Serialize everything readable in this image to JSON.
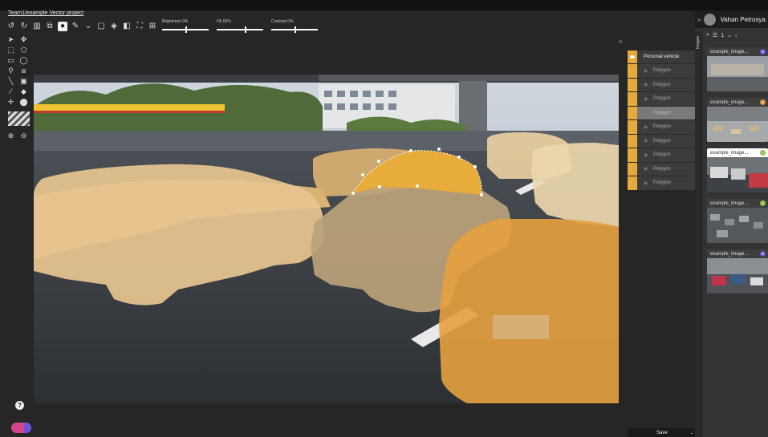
{
  "breadcrumb": {
    "team": "Team1",
    "separator": "/",
    "project": "example Vector project"
  },
  "toolbar": {
    "icons": [
      "undo-icon",
      "redo-icon",
      "trash-icon",
      "copy-icon",
      "eye-icon",
      "brush-icon",
      "chevron-down-icon",
      "comment-icon",
      "fill-icon",
      "fill-dark-icon",
      "fit-icon",
      "expand-icon"
    ],
    "sliders": [
      {
        "label": "Brightness 0%",
        "value": 0
      },
      {
        "label": "Fill 60%",
        "value": 60
      },
      {
        "label": "Contrast 0%",
        "value": 0
      }
    ]
  },
  "left_tools": {
    "rows": [
      [
        "cursor-icon",
        "crosshair-icon"
      ],
      [
        "polygon-select-icon",
        "polygon-icon"
      ],
      [
        "rectangle-icon",
        "ellipse-icon"
      ],
      [
        "template-icon",
        "cuboid-icon"
      ],
      [
        "line-icon",
        "comment-tool-icon"
      ],
      [
        "eyedropper-icon",
        "tag-icon"
      ],
      [
        "move-icon",
        "point-icon"
      ]
    ],
    "zoom": [
      "zoom-in-icon",
      "zoom-out-icon"
    ]
  },
  "colors": {
    "annotation": "#e6a93d",
    "selected_polygon": "#e7ac3a",
    "toggle_left": "#d6448e",
    "toggle_right": "#6b55d9"
  },
  "class_panel": {
    "class_name": "Personal vehicle",
    "items": [
      {
        "label": "Polygon",
        "selected": false
      },
      {
        "label": "Polygon",
        "selected": false
      },
      {
        "label": "Polygon",
        "selected": false
      },
      {
        "label": "Polygon",
        "selected": true
      },
      {
        "label": "Polygon",
        "selected": false
      },
      {
        "label": "Polygon",
        "selected": false
      },
      {
        "label": "Polygon",
        "selected": false
      },
      {
        "label": "Polygon",
        "selected": false
      },
      {
        "label": "Polygon",
        "selected": false
      }
    ],
    "save_label": "Save"
  },
  "right_sidebar": {
    "user_name": "Vahan Petrosya",
    "tab_label": "Images",
    "list_count": "1",
    "thumbnails": [
      {
        "caption": "example_image...",
        "status_color": "#6b55d9",
        "status": "in-progress",
        "selected": false
      },
      {
        "caption": "example_image...",
        "status_color": "#e48a3c",
        "status": "returned",
        "selected": false
      },
      {
        "caption": "example_image...",
        "status_color": "#8bc34a",
        "status": "completed",
        "selected": true
      },
      {
        "caption": "example_image...",
        "status_color": "#8bc34a",
        "status": "completed",
        "selected": false
      },
      {
        "caption": "example_image...",
        "status_color": "#6b55d9",
        "status": "in-progress",
        "selected": false
      }
    ]
  }
}
